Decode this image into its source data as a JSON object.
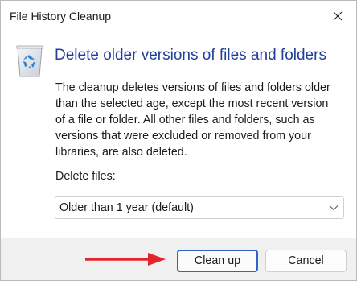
{
  "window": {
    "title": "File History Cleanup"
  },
  "header": {
    "heading": "Delete older versions of files and folders",
    "icon": "recycle-bin-icon"
  },
  "description": {
    "lines": [
      "The cleanup deletes versions of files and folders older",
      "than the selected age, except the most recent version",
      "of a file or folder. All other files and folders, such as",
      "versions that were excluded or removed from your",
      "libraries, are also deleted."
    ]
  },
  "delete_files": {
    "label": "Delete files:",
    "selected": "Older than 1 year (default)"
  },
  "buttons": {
    "clean_up": "Clean up",
    "cancel": "Cancel"
  },
  "annotation": {
    "arrow_color": "#e0262b"
  },
  "colors": {
    "heading": "#1f3f9a",
    "primary_border": "#2f63c7",
    "footer_bg": "#f0f0f0"
  }
}
